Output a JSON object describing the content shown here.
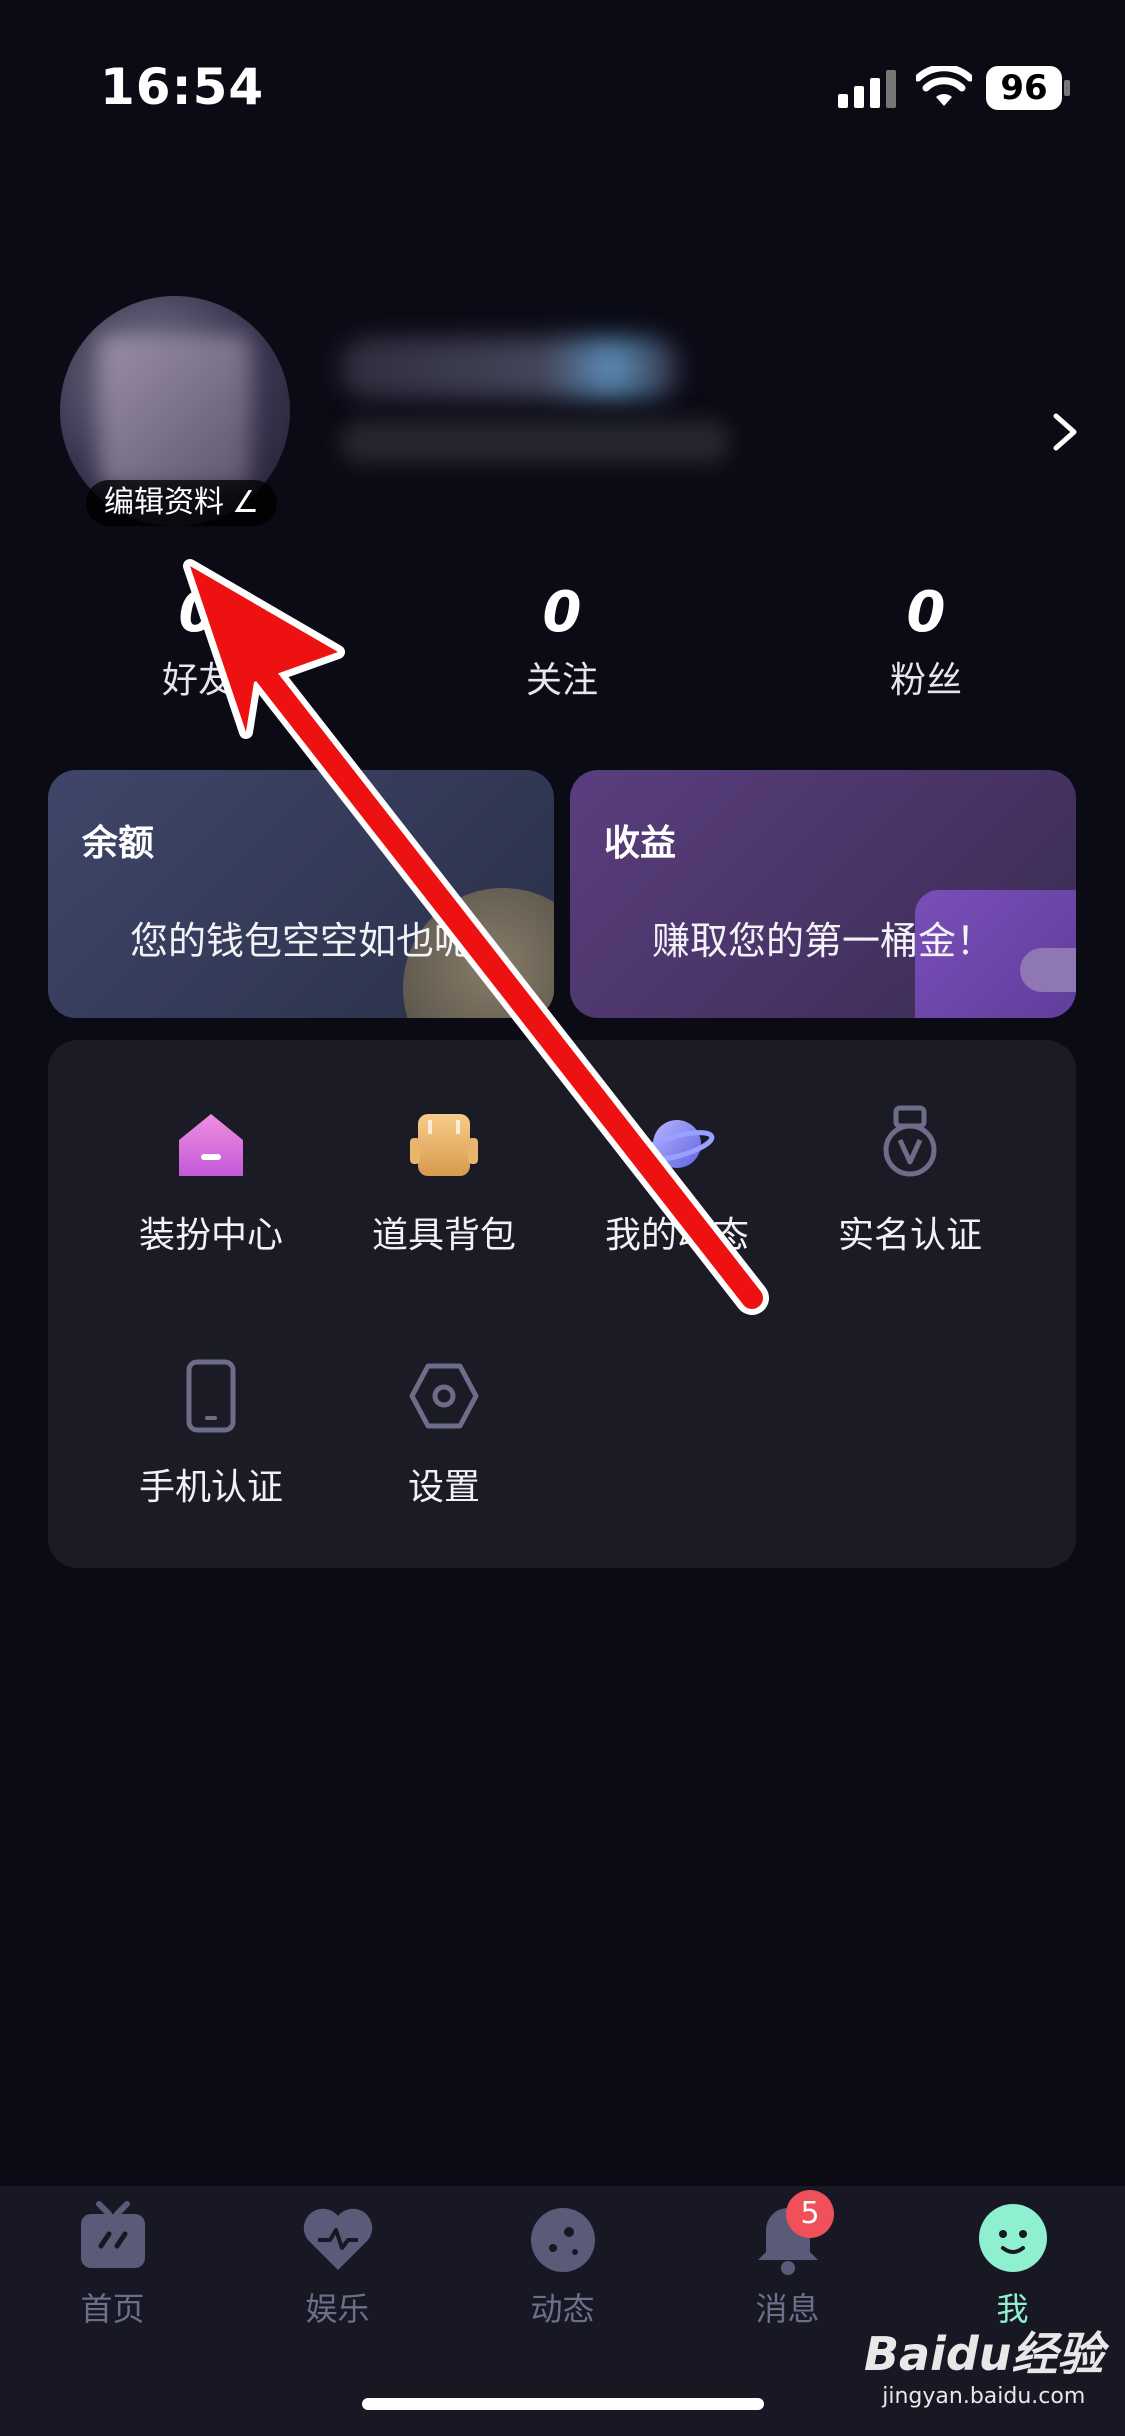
{
  "status_bar": {
    "time": "16:54",
    "battery": "96"
  },
  "profile": {
    "edit_label": "编辑资料"
  },
  "stats": [
    {
      "count": "0",
      "label": "好友"
    },
    {
      "count": "0",
      "label": "关注"
    },
    {
      "count": "0",
      "label": "粉丝"
    }
  ],
  "cards": {
    "balance": {
      "title": "余额",
      "desc": "您的钱包空空如也呢"
    },
    "income": {
      "title": "收益",
      "desc": "赚取您的第一桶金！"
    }
  },
  "menu": [
    {
      "label": "装扮中心",
      "icon": "house-icon"
    },
    {
      "label": "道具背包",
      "icon": "backpack-icon"
    },
    {
      "label": "我的动态",
      "icon": "planet-icon"
    },
    {
      "label": "实名认证",
      "icon": "medal-icon"
    },
    {
      "label": "手机认证",
      "icon": "phone-icon"
    },
    {
      "label": "设置",
      "icon": "hexagon-settings-icon"
    }
  ],
  "tabs": [
    {
      "label": "首页",
      "icon": "tv-icon"
    },
    {
      "label": "娱乐",
      "icon": "heart-pulse-icon"
    },
    {
      "label": "动态",
      "icon": "planet-face-icon"
    },
    {
      "label": "消息",
      "icon": "bell-icon",
      "badge": "5"
    },
    {
      "label": "我",
      "icon": "smile-face-icon",
      "active": true
    }
  ],
  "watermark": {
    "brand": "Baidu经验",
    "url": "jingyan.baidu.com"
  },
  "colors": {
    "accent_active": "#8ff0d0",
    "badge": "#f0505a",
    "annotation_arrow": "#ee1111"
  }
}
